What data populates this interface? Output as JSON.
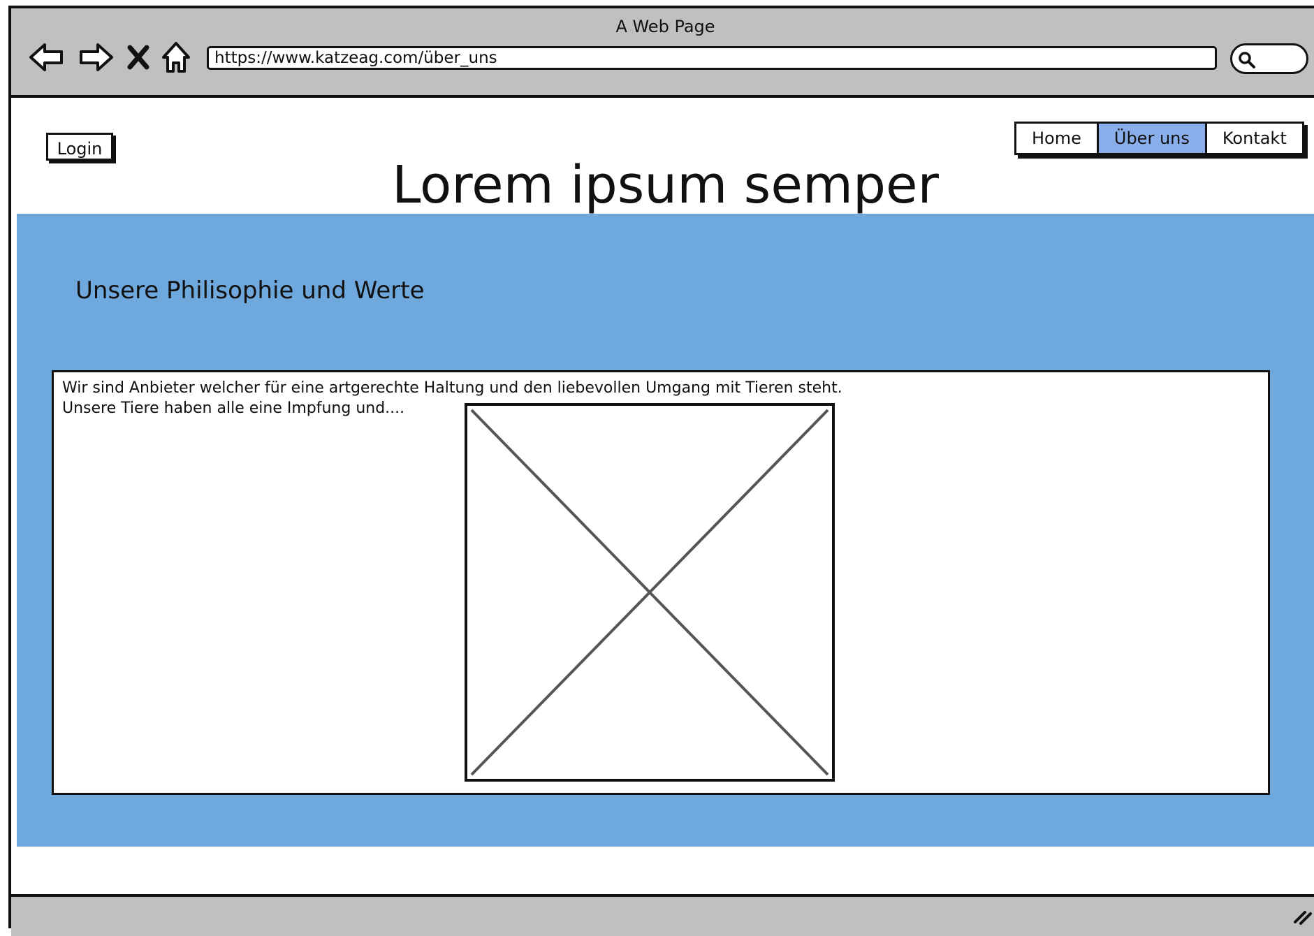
{
  "window": {
    "title": "A Web Page"
  },
  "browser": {
    "url": "https://www.katzeag.com/über_uns",
    "icons": [
      "back-arrow-icon",
      "forward-arrow-icon",
      "close-icon",
      "home-icon",
      "search-icon"
    ]
  },
  "header": {
    "login_label": "Login",
    "title": "Lorem ipsum semper",
    "nav": [
      {
        "label": "Home",
        "active": false
      },
      {
        "label": "Über uns",
        "active": true
      },
      {
        "label": "Kontakt",
        "active": false
      }
    ]
  },
  "main": {
    "heading": "Unsere Philisophie und Werte",
    "text_line_1": "Wir sind Anbieter welcher für eine artgerechte Haltung und den liebevollen Umgang mit Tieren steht.",
    "text_line_2": "Unsere Tiere haben alle eine Impfung und...."
  },
  "colors": {
    "chrome": "#c0c0c0",
    "section_background": "#6fa8dc",
    "active_tab": "#8aaee9",
    "outline": "#111111"
  }
}
